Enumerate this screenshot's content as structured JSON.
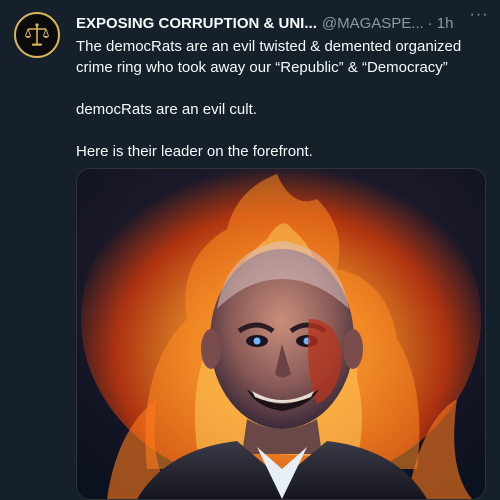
{
  "tweet": {
    "display_name": "EXPOSING CORRUPTION & UNI...",
    "handle": "@MAGASPE...",
    "separator": "·",
    "timestamp": "1h",
    "more_label": "···",
    "lines": [
      "The democRats are an evil twisted & demented organized crime ring who took away our “Republic” & “Democracy”",
      "democRats are an evil cult.",
      "Here is their leader on the forefront."
    ]
  },
  "colors": {
    "background": "#15202b",
    "primary_text": "#f7f9f9",
    "secondary_text": "#8b98a5",
    "avatar_accent": "#d7b45a"
  },
  "icons": {
    "avatar": "scales-of-justice-icon",
    "more": "more-horizontal-icon"
  }
}
